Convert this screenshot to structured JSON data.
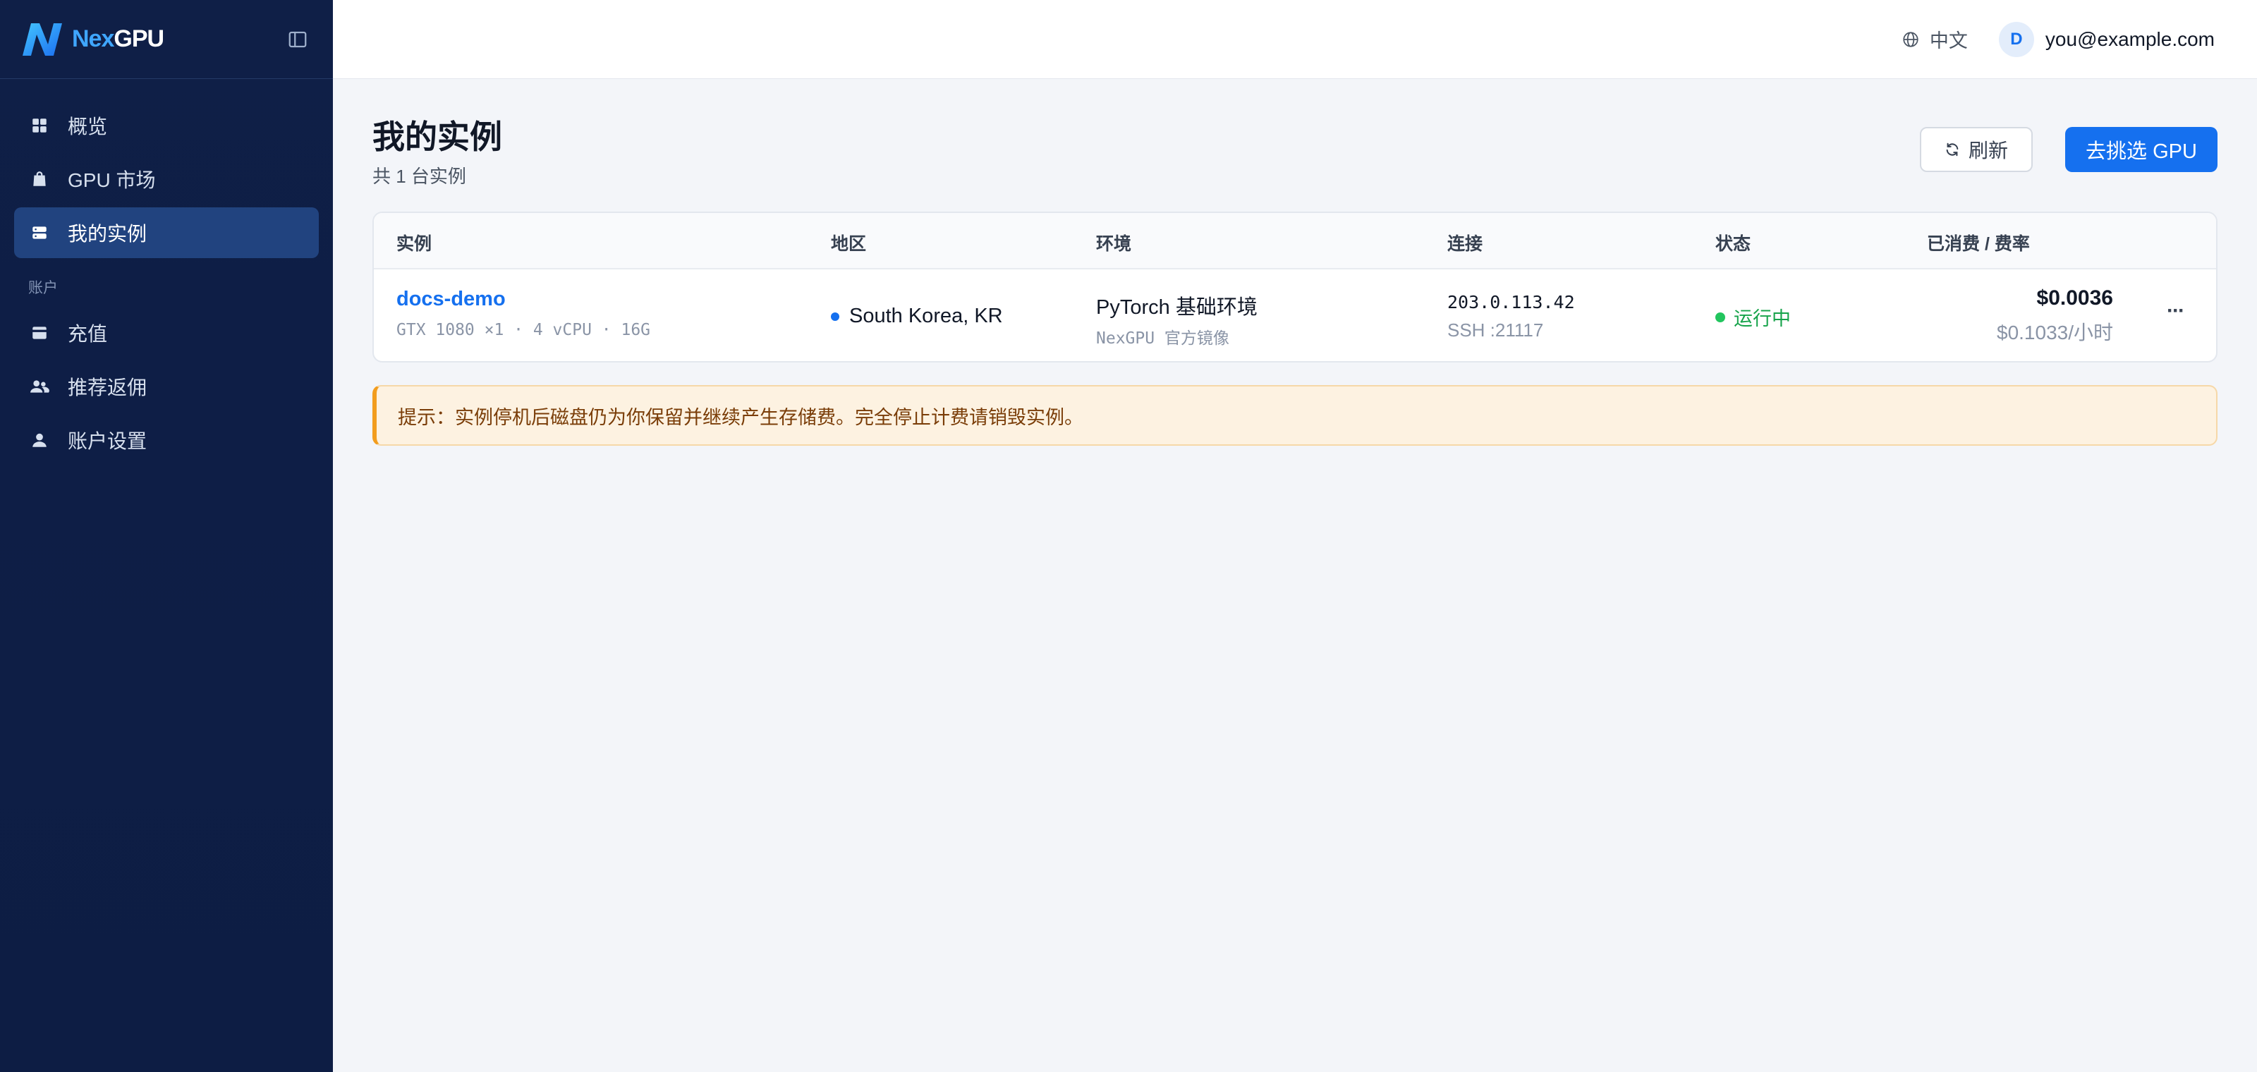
{
  "brand": {
    "name_prefix": "Nex",
    "name_suffix": "GPU"
  },
  "sidebar": {
    "items": [
      {
        "label": "概览",
        "icon": "grid-icon",
        "active": false
      },
      {
        "label": "GPU 市场",
        "icon": "shopping-bag-icon",
        "active": false
      },
      {
        "label": "我的实例",
        "icon": "server-icon",
        "active": true
      }
    ],
    "section_account": "账户",
    "account_items": [
      {
        "label": "充值",
        "icon": "credit-card-icon"
      },
      {
        "label": "推荐返佣",
        "icon": "users-icon"
      },
      {
        "label": "账户设置",
        "icon": "user-icon"
      }
    ]
  },
  "topbar": {
    "language": "中文",
    "user_initial": "D",
    "user_email": "you@example.com"
  },
  "page": {
    "title": "我的实例",
    "subtitle": "共 1 台实例",
    "refresh_label": "刷新",
    "primary_label": "去挑选 GPU"
  },
  "table": {
    "headers": [
      "实例",
      "地区",
      "环境",
      "连接",
      "状态",
      "已消费 / 费率"
    ],
    "rows": [
      {
        "name": "docs-demo",
        "spec": "GTX 1080 ×1 · 4 vCPU · 16G",
        "region": "South Korea, KR",
        "env_name": "PyTorch 基础环境",
        "env_source": "NexGPU 官方镜像",
        "ip": "203.0.113.42",
        "ssh": "SSH :21117",
        "status": "运行中",
        "spent": "$0.0036",
        "rate": "$0.1033/小时",
        "more": "···"
      }
    ]
  },
  "notice": "提示：实例停机后磁盘仍为你保留并继续产生存储费。完全停止计费请销毁实例。",
  "colors": {
    "accent": "#1570ef",
    "sidebar_bg": "#0f1f47",
    "sidebar_active": "#21437f",
    "running": "#16a34a",
    "notice_bg": "#fdf2e1",
    "notice_border": "#f29d1e"
  }
}
